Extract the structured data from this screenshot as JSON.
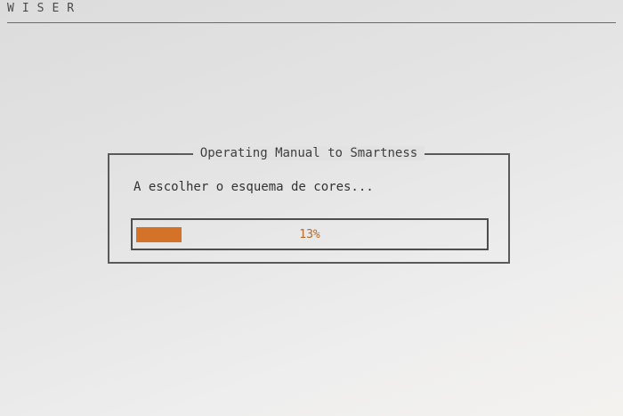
{
  "header": {
    "brand": "WISER"
  },
  "dialog": {
    "title": "Operating Manual to Smartness",
    "status_text": "A escolher o esquema de cores...",
    "progress": {
      "percent": 13,
      "label": "13%",
      "fill_color": "#d4722a"
    }
  },
  "colors": {
    "accent": "#d4722a",
    "border": "#5a5a5a",
    "background": "#e6e6e6"
  }
}
